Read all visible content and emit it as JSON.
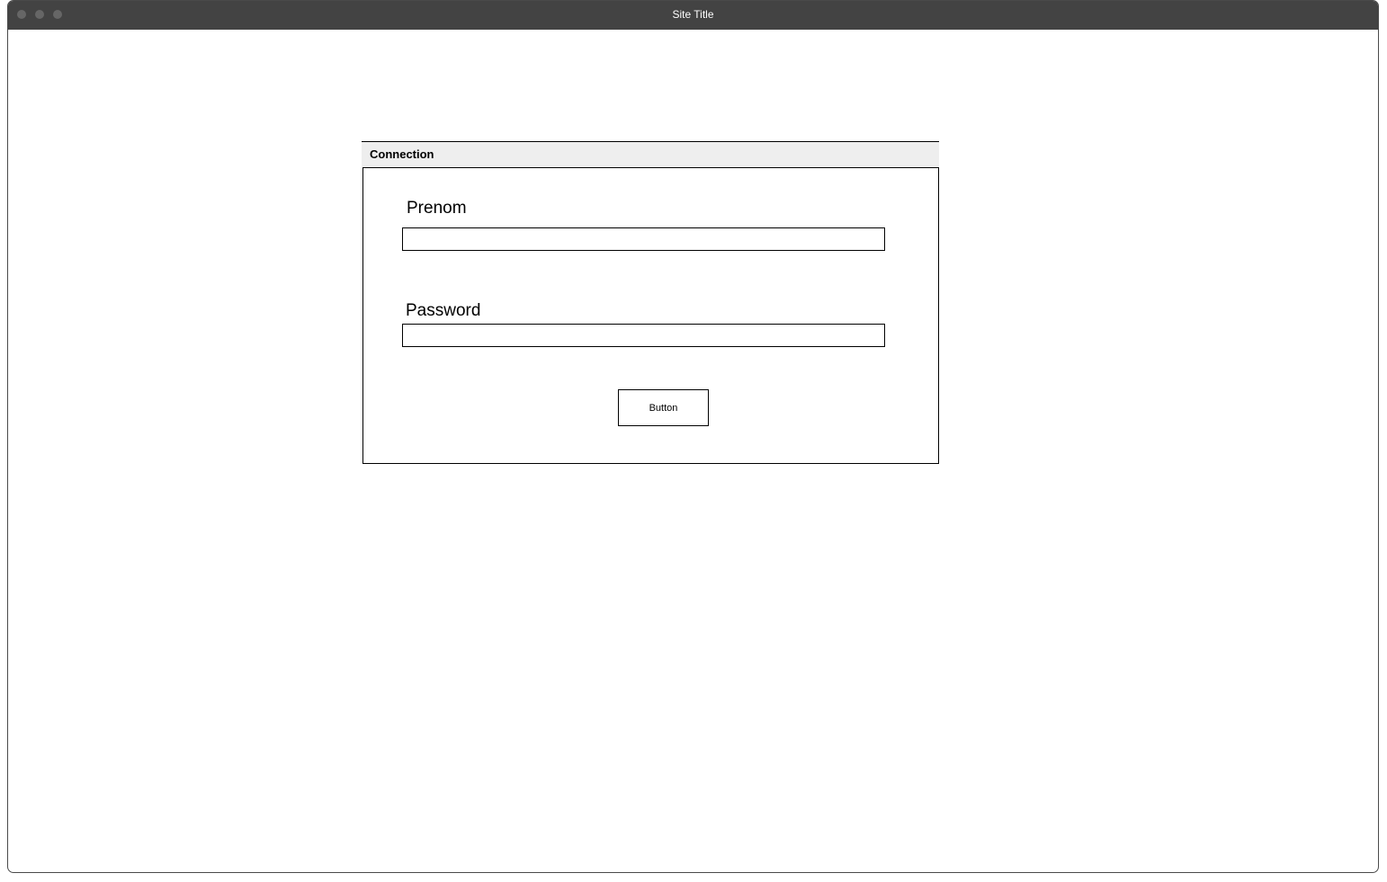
{
  "window": {
    "title": "Site Title"
  },
  "panel": {
    "title": "Connection"
  },
  "form": {
    "first_name": {
      "label": "Prenom",
      "value": "",
      "placeholder": ""
    },
    "password": {
      "label": "Password",
      "value": "",
      "placeholder": ""
    },
    "submit_label": "Button"
  },
  "colors": {
    "titlebar_bg": "#434343",
    "titlebar_text": "#ffffff",
    "panel_header_bg": "#eeeeee",
    "border": "#000000",
    "window_dot": "#666666"
  }
}
